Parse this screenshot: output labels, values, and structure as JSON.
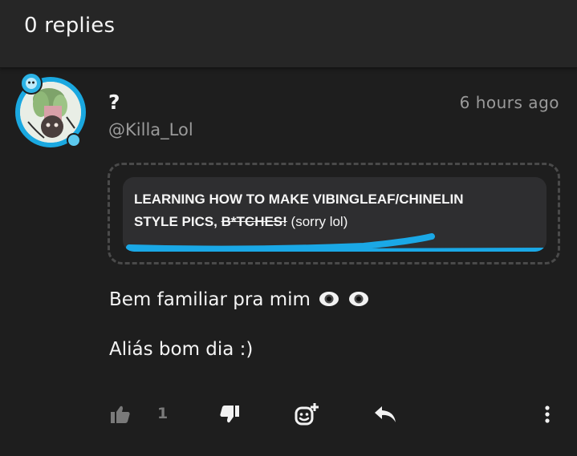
{
  "header": {
    "title": "0 replies"
  },
  "comment": {
    "username": "?",
    "handle": "@Killa_Lol",
    "timestamp": "6 hours ago",
    "quote": {
      "line1": "LEARNING HOW TO MAKE VIBINGLEAF/CHINELIN",
      "line2_bold": "STYLE PICS, ",
      "line2_strike": "B*TCHES!",
      "line2_plain": " (sorry lol)",
      "accent_color": "#1aa8e6"
    },
    "message_line1": "Bem familiar pra mim",
    "message_line2": "Aliás bom dia :)"
  },
  "actions": {
    "like_count": "1",
    "icons": [
      "thumbs-up-icon",
      "thumbs-down-icon",
      "add-reaction-icon",
      "reply-icon",
      "more-vertical-icon"
    ]
  },
  "colors": {
    "background": "#1e1e1e",
    "header_bg": "#262626",
    "avatar_ring": "#1aa8e0",
    "muted_text": "#9a9a9a"
  }
}
